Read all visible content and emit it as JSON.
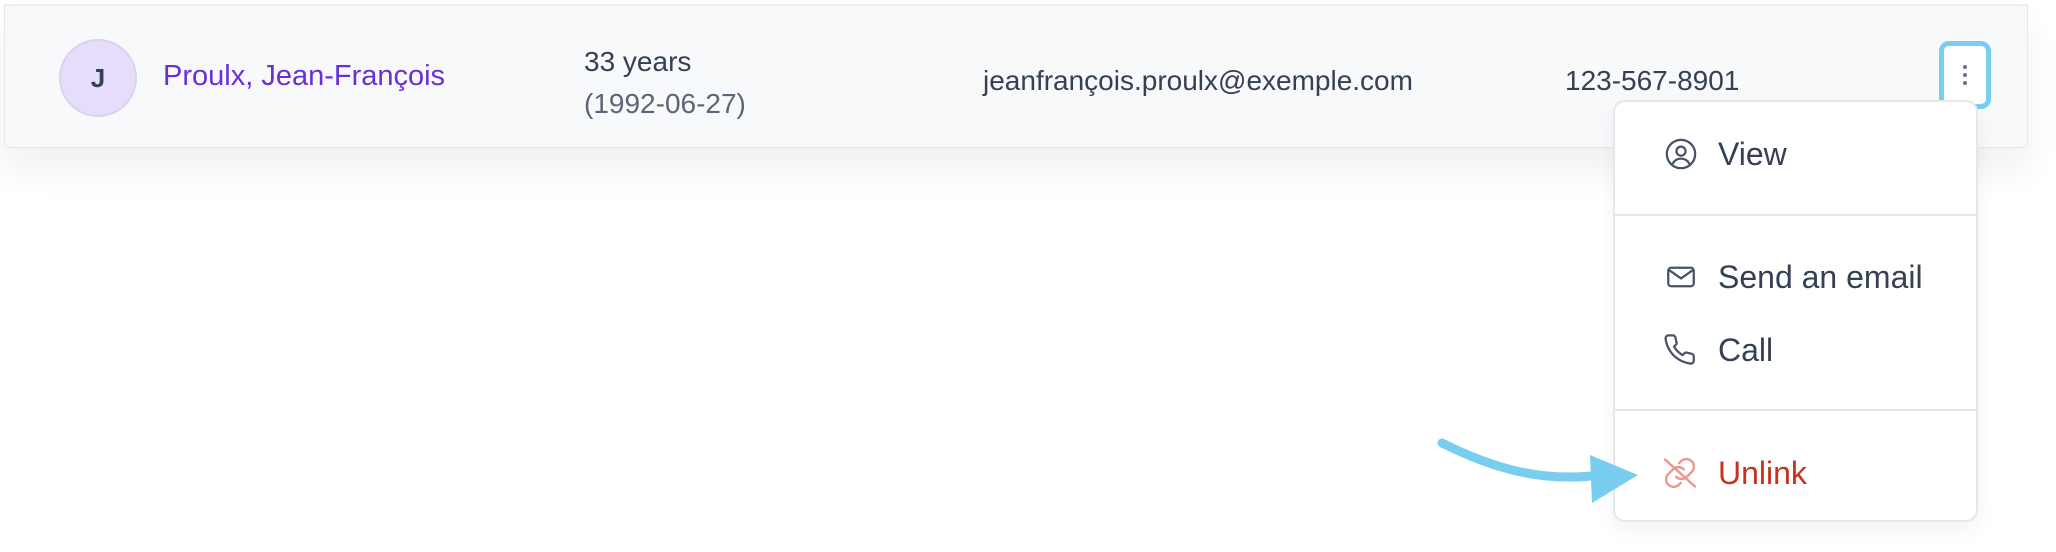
{
  "contact": {
    "avatar_initial": "J",
    "name": "Proulx, Jean-François",
    "age": "33 years",
    "birth_date": "(1992-06-27)",
    "email": "jeanfrançois.proulx@exemple.com",
    "phone": "123-567-8901"
  },
  "row_actions": {
    "menu_button_icon": "more-vertical-icon"
  },
  "menu": {
    "items": [
      {
        "label": "View",
        "icon": "user-circle-icon"
      },
      {
        "label": "Send an email",
        "icon": "mail-icon"
      },
      {
        "label": "Call",
        "icon": "phone-icon"
      },
      {
        "label": "Unlink",
        "icon": "unlink-icon"
      }
    ]
  },
  "colors": {
    "name_link": "#6a2fd6",
    "focus_ring": "#79cdef",
    "danger": "#c8321f",
    "danger_icon": "#f0958c",
    "annotation_arrow": "#79cdef"
  }
}
